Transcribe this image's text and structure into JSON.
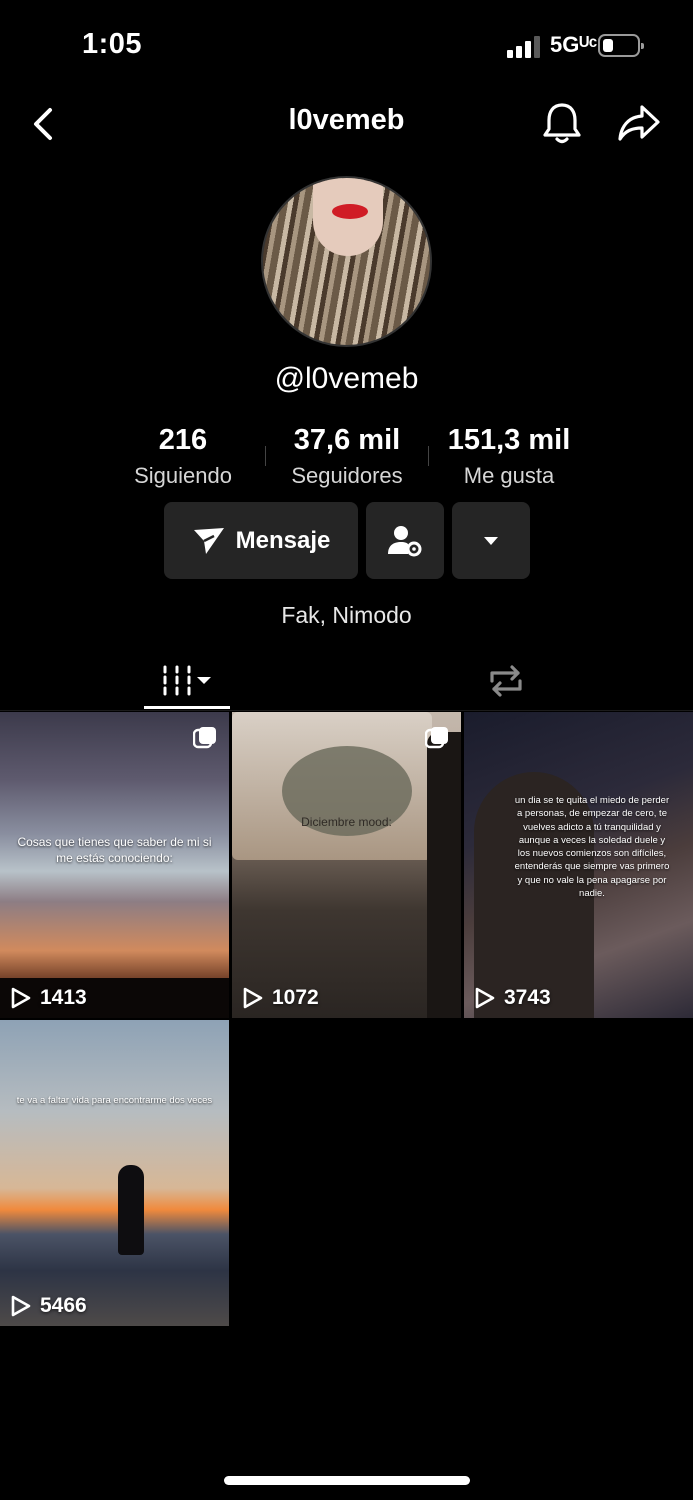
{
  "status_bar": {
    "time": "1:05",
    "network": "5Gᵁᶜ",
    "battery_level": 0.25
  },
  "nav": {
    "title": "l0vemeb"
  },
  "profile": {
    "handle": "@l0vemeb",
    "bio": "Fak, Nimodo",
    "stats": [
      {
        "value": "216",
        "label": "Siguiendo"
      },
      {
        "value": "37,6 mil",
        "label": "Seguidores"
      },
      {
        "value": "151,3 mil",
        "label": "Me gusta"
      }
    ]
  },
  "actions": {
    "message_label": "Mensaje"
  },
  "tabs": [
    {
      "name": "videos",
      "icon": "grid-icon",
      "active": true
    },
    {
      "name": "reposts",
      "icon": "repost-icon",
      "active": false
    }
  ],
  "videos": [
    {
      "caption": "Cosas que tienes que saber de mi si me estás conociendo:",
      "views": "1413",
      "multi": true
    },
    {
      "caption": "Diciembre mood:",
      "views": "1072",
      "multi": true
    },
    {
      "caption": "un dia se te quita el miedo de perder a personas, de empezar de cero, te vuelves adicto a tú tranquilidad y aunque a veces la soledad duele y los nuevos comienzos son difíciles, entenderás que siempre vas primero y que no vale la pena apagarse por nadie.",
      "views": "3743",
      "multi": false
    },
    {
      "caption": "te va a faltar vida para encontrarme dos veces",
      "views": "5466",
      "multi": false
    }
  ]
}
